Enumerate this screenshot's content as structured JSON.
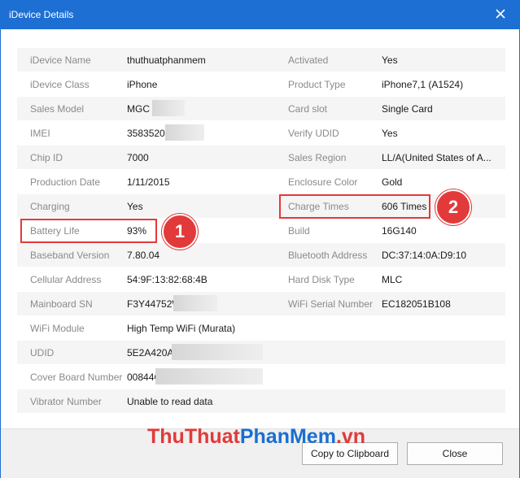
{
  "window": {
    "title": "iDevice Details"
  },
  "rows": [
    {
      "l1": "iDevice Name",
      "v1": "thuthuatphanmem",
      "l2": "Activated",
      "v2": "Yes"
    },
    {
      "l1": "iDevice Class",
      "v1": "iPhone",
      "l2": "Product Type",
      "v2": "iPhone7,1 (A1524)"
    },
    {
      "l1": "Sales Model",
      "v1": "MGC",
      "l2": "Card slot",
      "v2": "Single Card"
    },
    {
      "l1": "IMEI",
      "v1": "3583520",
      "l2": "Verify UDID",
      "v2": "Yes"
    },
    {
      "l1": "Chip ID",
      "v1": "7000",
      "l2": "Sales Region",
      "v2": "LL/A(United States of A..."
    },
    {
      "l1": "Production Date",
      "v1": "1/11/2015",
      "l2": "Enclosure Color",
      "v2": "Gold"
    },
    {
      "l1": "Charging",
      "v1": "Yes",
      "l2": "Charge Times",
      "v2": "606 Times"
    },
    {
      "l1": "Battery Life",
      "v1": "93%",
      "l2": "Build",
      "v2": "16G140"
    },
    {
      "l1": "Baseband Version",
      "v1": "7.80.04",
      "l2": "Bluetooth Address",
      "v2": "DC:37:14:0A:D9:10"
    },
    {
      "l1": "Cellular Address",
      "v1": "54:9F:13:82:68:4B",
      "l2": "Hard Disk Type",
      "v2": "MLC"
    },
    {
      "l1": "Mainboard SN",
      "v1": "F3Y44752W",
      "l2": "WiFi Serial Number",
      "v2": "EC182051B108"
    },
    {
      "l1": "WiFi Module",
      "v1": "High Temp WiFi (Murata)",
      "l2": "",
      "v2": ""
    },
    {
      "l1": "UDID",
      "v1": "5E2A420A",
      "l2": "",
      "v2": ""
    },
    {
      "l1": "Cover Board Number",
      "v1": "00844C",
      "l2": "",
      "v2": ""
    },
    {
      "l1": "Vibrator Number",
      "v1": "Unable to read data",
      "l2": "",
      "v2": ""
    }
  ],
  "annotations": {
    "badge1": "1",
    "badge2": "2"
  },
  "buttons": {
    "copy": "Copy to Clipboard",
    "close": "Close"
  },
  "watermark": {
    "part1": "ThuThuat",
    "part2": "PhanMem",
    "part3": ".vn"
  },
  "colors": {
    "titlebar": "#1d6fd3",
    "highlight": "#e23a3a",
    "row_alt": "#f5f5f5"
  }
}
